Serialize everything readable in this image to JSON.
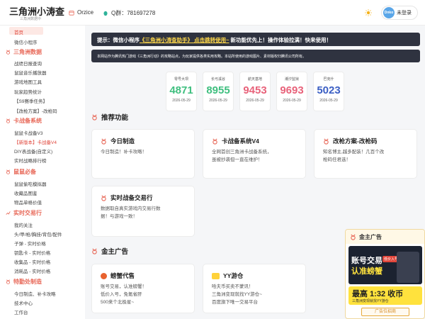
{
  "header": {
    "title": "三角洲小涛查",
    "subtitle": "三角洲数据中",
    "author": "Orzice",
    "qq_group": "Q群：781697278",
    "login_avatar": "Dnko",
    "login_label": "未登录"
  },
  "sidebar": {
    "top_items": [
      "首页",
      "微信小程序"
    ],
    "groups": [
      {
        "title": "三角洲数据",
        "items": [
          "战绩日报查询",
          "鼠鼠音乐播放器",
          "游戏地图工具",
          "玩家趋势统计",
          "【S9赛季任务】",
          "【改枪方案】-改枪码"
        ]
      },
      {
        "title": "卡战备系统",
        "items": [
          "鼠鼠卡战备V3",
          "【新版本】卡战备V4",
          "DIY表战备(自定义)",
          "实时战略排行榜"
        ]
      },
      {
        "title": "鼠鼠必备",
        "items": [
          "鼠鼠偷吃模拟器",
          "收藏品图鉴",
          "物品单格价值"
        ]
      },
      {
        "title": "实时交易行",
        "items": [
          "我的关注",
          "头/甲/枪/胸挂/背包/配件",
          "子弹 - 实时价格",
          "钥匙卡 - 实时价格",
          "收集品 - 实时价格",
          "消耗品 - 实时价格"
        ]
      },
      {
        "title": "特勤处制造",
        "items": [
          "今日制造、补卡攻略",
          "技术中心",
          "工作台"
        ]
      }
    ]
  },
  "notices": {
    "n1_prefix": "提示：微信小程序",
    "n1_link": "《三角洲小涛查助手》 点击跳转使用~",
    "n1_suffix": " 新功能优先上！操作体验拉满！快来使用！",
    "n2": "本网站作为腾讯热门游戏《三角洲行动》的攻略站点，为玩家提供各类实用攻略。本站所使用的游戏图片、素材版权归腾讯公司所有。"
  },
  "codes": [
    {
      "name": "零号大坝",
      "value": "4871",
      "date": "2026-05-29",
      "color": "#3fbf7f"
    },
    {
      "name": "长弓溪谷",
      "value": "8955",
      "date": "2026-05-29",
      "color": "#3fbf7f"
    },
    {
      "name": "航天基地",
      "value": "9453",
      "date": "2026-05-29",
      "color": "#e8627a"
    },
    {
      "name": "潮汐监狱",
      "value": "9693",
      "date": "2026-05-29",
      "color": "#e8627a"
    },
    {
      "name": "巴克什",
      "value": "5023",
      "date": "2026-05-29",
      "color": "#3b5fc4"
    }
  ],
  "features": {
    "title": "推荐功能",
    "cards": [
      {
        "title": "今日制造",
        "desc": "今日制造！补卡攻略！"
      },
      {
        "title": "卡战备系统V4",
        "desc": "全网首创三角洲卡战备系统，\n虽被抄袭但一直在维护！"
      },
      {
        "title": "改枪方案-改枪码",
        "desc": "知名博主,越多配装！几百个改\n枪码任君选！"
      },
      {
        "title": "实时战备交易行",
        "desc": "数据取自真实游戏内交易行数\n据！与游戏一致！"
      }
    ]
  },
  "ads_section": {
    "title": "金主广告",
    "cards": [
      {
        "title": "螃蟹代售",
        "desc": "账号交易，认准螃蟹！\n低价入号，免氪省肝\n500来个北极星~"
      },
      {
        "title": "YY游仓",
        "desc": "哈夫币买卖不蒙讯！\n三角洲变现就找YY游仓~\n百度旗下唯一交易平台"
      }
    ]
  },
  "ad_panel": {
    "title": "金主广告",
    "banner1_line1": "账号交易",
    "banner1_line2": "认准螃蟹",
    "banner1_tag": "低价入号",
    "banner2_text": "最高 1:32 收币",
    "banner2_sub": "三角洲变现就找YY游仓",
    "cta": "广告位招商"
  }
}
